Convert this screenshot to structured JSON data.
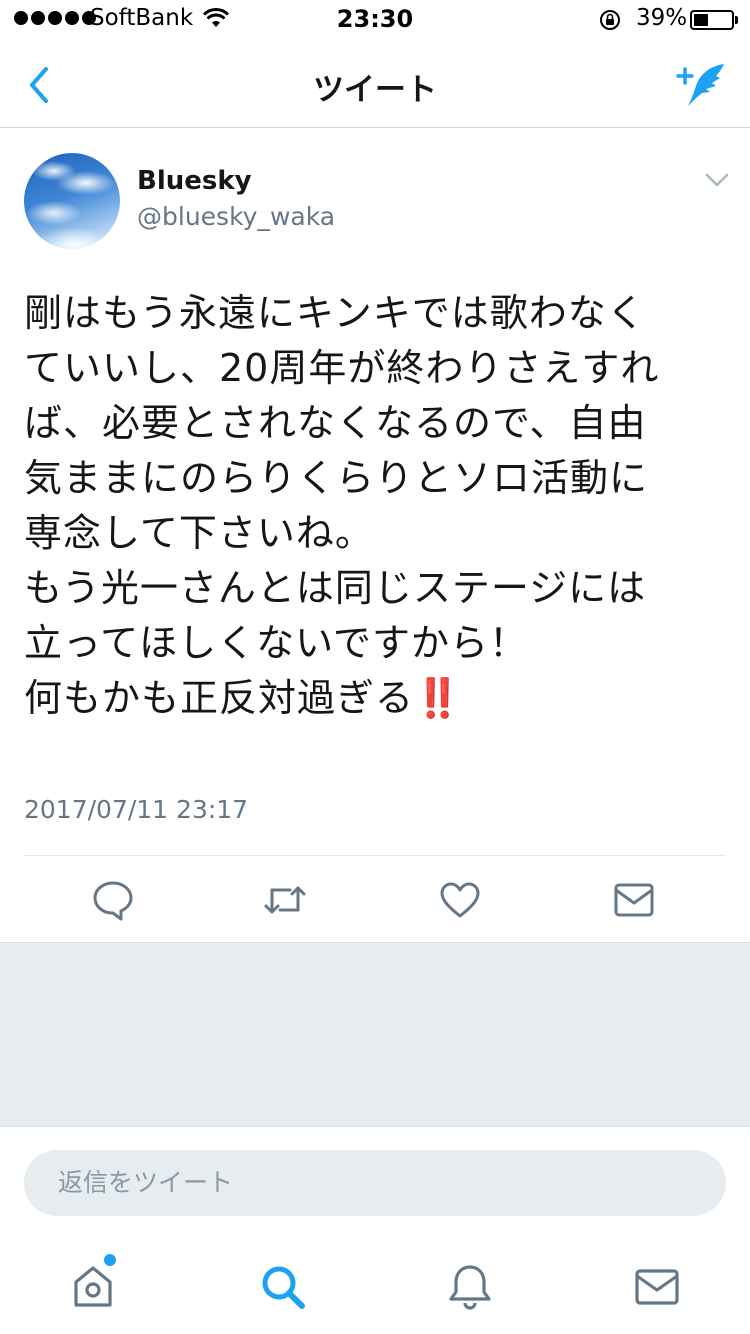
{
  "status_bar": {
    "carrier": "SoftBank",
    "time": "23:30",
    "battery_percent": "39%",
    "battery_level": 0.39
  },
  "nav": {
    "title": "ツイート",
    "back_icon": "chevron-left-icon",
    "compose_icon": "compose-tweet-icon"
  },
  "tweet": {
    "user_name": "Bluesky",
    "user_handle": "@bluesky_waka",
    "text_lines": [
      "剛はもう永遠にキンキでは歌わなく",
      "ていいし、20周年が終わりさえすれ",
      "ば、必要とされなくなるので、自由",
      "気ままにのらりくらりとソロ活動に",
      "専念して下さいね。",
      "もう光一さんとは同じステージには",
      "立ってほしくないですから！",
      "何もかも正反対過ぎる‼️"
    ],
    "timestamp": "2017/07/11 23:17"
  },
  "actions": {
    "reply_icon": "reply-icon",
    "retweet_icon": "retweet-icon",
    "like_icon": "heart-icon",
    "dm_icon": "envelope-icon"
  },
  "reply": {
    "placeholder": "返信をツイート"
  },
  "tabs": [
    {
      "icon": "home-icon"
    },
    {
      "icon": "search-icon"
    },
    {
      "icon": "bell-icon"
    },
    {
      "icon": "envelope-icon"
    }
  ],
  "colors": {
    "accent": "#1da1f2",
    "secondary_text": "#657786",
    "icon_gray": "#657786",
    "background_gray": "#e6ecf0"
  }
}
